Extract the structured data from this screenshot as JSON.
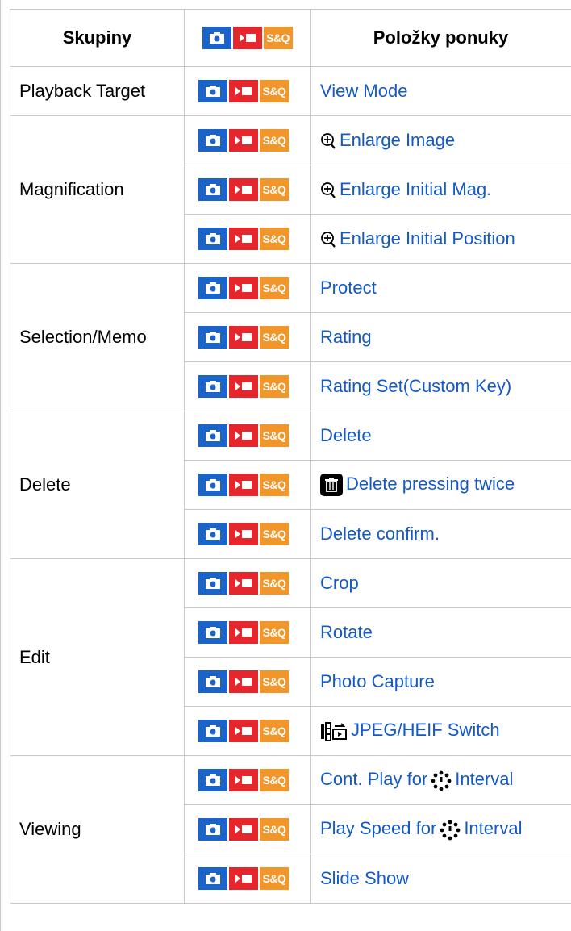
{
  "header": {
    "col1": "Skupiny",
    "col3": "Položky ponuky"
  },
  "badges": {
    "sq_label": "S&Q"
  },
  "groups": [
    {
      "name": "Playback Target",
      "items": [
        "View Mode"
      ]
    },
    {
      "name": "Magnification",
      "items": [
        "Enlarge Image",
        "Enlarge Initial Mag.",
        "Enlarge Initial Position"
      ]
    },
    {
      "name": "Selection/Memo",
      "items": [
        "Protect",
        "Rating",
        "Rating Set(Custom Key)"
      ]
    },
    {
      "name": "Delete",
      "items": [
        "Delete",
        "Delete pressing twice",
        "Delete confirm."
      ]
    },
    {
      "name": "Edit",
      "items": [
        "Crop",
        "Rotate",
        "Photo Capture",
        "JPEG/HEIF Switch"
      ]
    },
    {
      "name": "Viewing",
      "items": [
        "Cont. Play for",
        "Play Speed for",
        "Slide Show"
      ]
    }
  ],
  "suffixes": {
    "interval": "Interval"
  },
  "colors": {
    "camera_badge": "#1a63c8",
    "movie_badge": "#e5262c",
    "sq_badge": "#f1962a",
    "link": "#1459c4"
  }
}
